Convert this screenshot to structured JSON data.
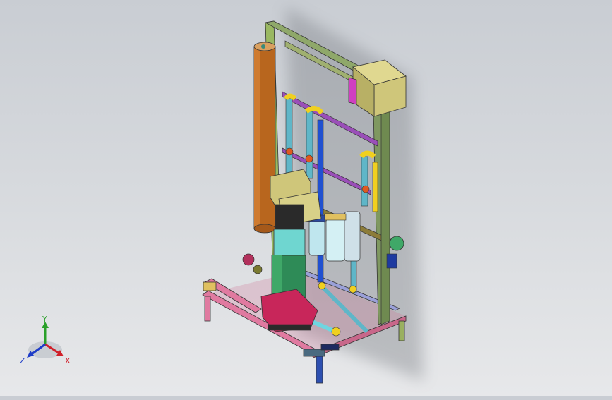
{
  "viewport": {
    "background_top": "#c9cdd3",
    "background_bottom": "#e7e8ea"
  },
  "triad": {
    "x_label": "X",
    "y_label": "Y",
    "z_label": "Z",
    "x_color": "#d0202a",
    "y_color": "#2aa02a",
    "z_color": "#1e3cc8"
  },
  "model": {
    "frame_color": "#8fa86a",
    "tank_color": "#b8661e",
    "motor_color": "#cfc67a",
    "pump_body_color": "#2e8b57",
    "pump_head_color": "#c8265a",
    "stand_color": "#e07aa0",
    "control_box_color": "#cfc67a",
    "pipe_yellow": "#f0d020",
    "pipe_blue": "#2050d0",
    "pipe_cyan": "#6fd6e0"
  }
}
